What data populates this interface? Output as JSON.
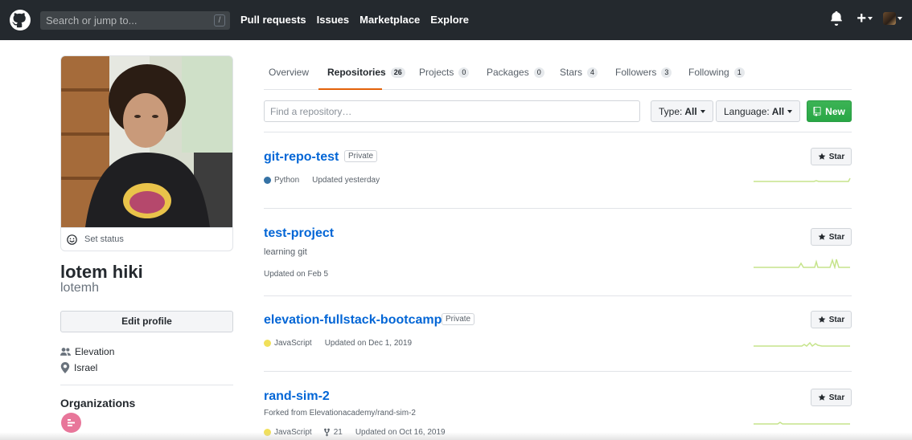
{
  "header": {
    "search_placeholder": "Search or jump to...",
    "search_shortcut": "/",
    "nav": [
      "Pull requests",
      "Issues",
      "Marketplace",
      "Explore"
    ],
    "plus_label": "+"
  },
  "profile": {
    "status_label": "Set status",
    "full_name": "lotem hiki",
    "username": "lotemh",
    "edit_label": "Edit profile",
    "organization_line": "Elevation",
    "location": "Israel",
    "orgs_title": "Organizations"
  },
  "tabs": [
    {
      "label": "Overview",
      "count": null
    },
    {
      "label": "Repositories",
      "count": "26"
    },
    {
      "label": "Projects",
      "count": "0"
    },
    {
      "label": "Packages",
      "count": "0"
    },
    {
      "label": "Stars",
      "count": "4"
    },
    {
      "label": "Followers",
      "count": "3"
    },
    {
      "label": "Following",
      "count": "1"
    }
  ],
  "toolbar": {
    "find_placeholder": "Find a repository…",
    "type_label": "Type:",
    "type_value": "All",
    "language_label": "Language:",
    "language_value": "All",
    "new_label": "New"
  },
  "repos": [
    {
      "name": "git-repo-test",
      "badge": "Private",
      "language": "Python",
      "lang_color": "#3572A5",
      "updated": "Updated yesterday",
      "star": "Star"
    },
    {
      "name": "test-project",
      "description": "learning git",
      "updated": "Updated on Feb 5",
      "star": "Star"
    },
    {
      "name": "elevation-fullstack-bootcamp",
      "badge": "Private",
      "language": "JavaScript",
      "lang_color": "#f1e05a",
      "updated": "Updated on Dec 1, 2019",
      "star": "Star"
    },
    {
      "name": "rand-sim-2",
      "description": "Forked from Elevationacademy/rand-sim-2",
      "language": "JavaScript",
      "lang_color": "#f1e05a",
      "forks": "21",
      "updated": "Updated on Oct 16, 2019",
      "star": "Star"
    }
  ],
  "colors": {
    "header_bg": "#24292e",
    "link_blue": "#0366d6",
    "tab_accent": "#e36209",
    "new_green": "#28a745",
    "spark_green": "#c6e48b"
  },
  "icons": [
    "github-logo-icon",
    "bell-icon",
    "plus-icon",
    "smiley-icon",
    "people-icon",
    "location-icon",
    "repo-icon",
    "star-icon",
    "fork-icon"
  ]
}
